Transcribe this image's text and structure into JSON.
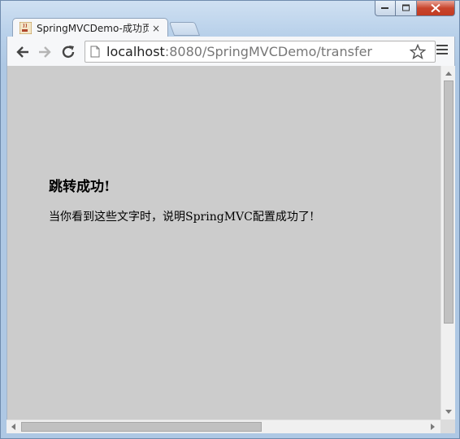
{
  "browser": {
    "tab": {
      "title": "SpringMVCDemo-成功页",
      "favicon": "java-cup-icon",
      "close_glyph": "×"
    },
    "url": {
      "host": "localhost",
      "rest": ":8080/SpringMVCDemo/transfer"
    },
    "icons": {
      "back": "back-arrow-icon",
      "forward": "forward-arrow-icon",
      "reload": "reload-icon",
      "page": "page-icon",
      "bookmark": "star-icon",
      "menu": "hamburger-menu-icon"
    }
  },
  "page": {
    "heading": "跳转成功!",
    "message": "当你看到这些文字时，说明SpringMVC配置成功了!"
  },
  "colors": {
    "page_background": "#cccccc",
    "window_frame": "#b9d1ea",
    "close_button": "#c8452d"
  }
}
